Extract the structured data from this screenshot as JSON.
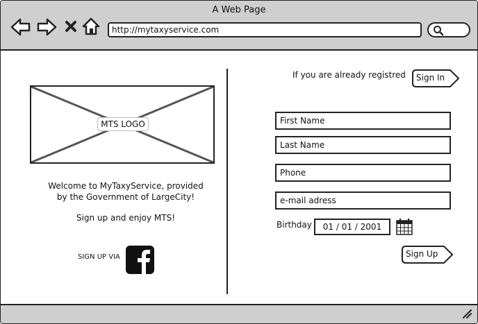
{
  "window": {
    "title": "A Web Page"
  },
  "browser": {
    "url": "http://mytaxyservice.com"
  },
  "left": {
    "logo_label": "MTS LOGO",
    "welcome_line1": "Welcome to MyTaxyService, provided",
    "welcome_line2": "by the Government of LargeCity!",
    "enjoy": "Sign up and enjoy MTS!",
    "signup_via": "SIGN UP VIA"
  },
  "right": {
    "already_text": "If you are already registred",
    "sign_in_label": "Sign In",
    "fields": {
      "first_name": "First Name",
      "last_name": "Last Name",
      "phone": "Phone",
      "email": "e-mail adress"
    },
    "birthday_label": "Birthday",
    "birthday_value": "01 / 01 / 2001",
    "sign_up_label": "Sign Up"
  },
  "icons": {
    "back": "arrow-left-icon",
    "forward": "arrow-right-icon",
    "stop": "close-icon",
    "home": "home-icon",
    "search": "search-icon",
    "facebook": "facebook-icon",
    "calendar": "calendar-icon",
    "resize": "resize-grip-icon"
  }
}
